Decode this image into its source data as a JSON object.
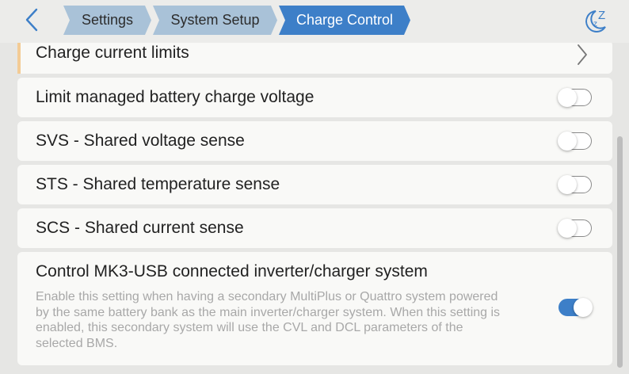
{
  "header": {
    "back_icon": "chevron-left-icon",
    "breadcrumbs": [
      "Settings",
      "System Setup",
      "Charge Control"
    ],
    "sleep_icon": "moon-sleep-icon",
    "accent_color": "#3d7fc8"
  },
  "rows": [
    {
      "label": "Charge current limits",
      "control": "chevron-right-icon"
    },
    {
      "label": "Limit managed battery charge voltage",
      "toggle": "off"
    },
    {
      "label": "SVS - Shared voltage sense",
      "toggle": "off"
    },
    {
      "label": "STS - Shared temperature sense",
      "toggle": "off"
    },
    {
      "label": "SCS - Shared current sense",
      "toggle": "off"
    },
    {
      "label": "Control MK3-USB connected inverter/charger system",
      "description": "Enable this setting when having a secondary MultiPlus or Quattro system powered by the same battery bank as the main inverter/charger system. When this setting is enabled, this secondary system will use the CVL and DCL parameters of the selected BMS.",
      "toggle": "on"
    }
  ]
}
